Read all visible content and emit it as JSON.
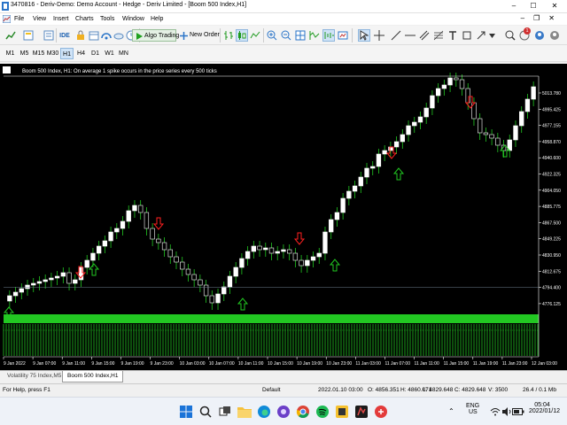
{
  "window": {
    "title": "3470816 - Deriv-Demo: Demo Account - Hedge - Deriv Limited - [Boom 500 Index,H1]",
    "controls": [
      "–",
      "☐",
      "✕"
    ]
  },
  "menu": {
    "items": [
      "File",
      "View",
      "Insert",
      "Charts",
      "Tools",
      "Window",
      "Help"
    ],
    "right_controls": [
      "–",
      "❐",
      "✕"
    ]
  },
  "toolbar": {
    "ide_label": "IDE",
    "algo_trading_label": "Algo Trading",
    "new_order_label": "New Order",
    "notification_count": "1"
  },
  "timeframes": {
    "items": [
      "M1",
      "M5",
      "M15",
      "M30",
      "H1",
      "H4",
      "D1",
      "W1",
      "MN"
    ],
    "active": "H1"
  },
  "chart": {
    "header_text": "Boom 500 Index, H1:  On average 1 spike occurs in the price series every 500 ticks",
    "price_labels": [
      "5013.780",
      "4995.425",
      "4977.155",
      "4958.870",
      "4940.600",
      "4922.325",
      "4904.050",
      "4885.775",
      "4867.500",
      "4849.225",
      "4830.950",
      "4812.675",
      "4794.400",
      "4776.125"
    ],
    "current_price_label": "4794.400",
    "time_labels": [
      "9 Jan 2022",
      "9 Jan 07:00",
      "9 Jan 11:00",
      "9 Jan 15:00",
      "9 Jan 19:00",
      "9 Jan 23:00",
      "10 Jan 03:00",
      "10 Jan 07:00",
      "10 Jan 11:00",
      "10 Jan 15:00",
      "10 Jan 19:00",
      "10 Jan 23:00",
      "11 Jan 03:00",
      "11 Jan 07:00",
      "11 Jan 11:00",
      "11 Jan 15:00",
      "11 Jan 19:00",
      "11 Jan 23:00",
      "12 Jan 03:00"
    ],
    "colors": {
      "background": "#000000",
      "bull_candle": "#ffffff",
      "bear_candle": "#ffffff",
      "wick": "#22c822",
      "up_arrow": "#22c822",
      "down_arrow": "#ff2020",
      "histogram": "#22c822"
    }
  },
  "chart_tabs": {
    "items": [
      "Volatility 75 Index,M5",
      "Boom 500 Index,H1"
    ],
    "active_index": 1
  },
  "status": {
    "help": "For Help, press F1",
    "profile": "Default",
    "datetime": "2022.01.10 03:00",
    "open": "O: 4856.351",
    "high": "H: 4860.071",
    "low": "L: 4829.648",
    "close": "C: 4829.648",
    "volume": "V: 3500",
    "traffic": "26.4 / 0.1 Mb"
  },
  "taskbar": {
    "apps": [
      "windows-start",
      "search",
      "task-view",
      "file-explorer",
      "edge",
      "app-purple",
      "chrome",
      "spotify",
      "app-yellow",
      "metatrader",
      "app-red"
    ],
    "tray": {
      "lang_top": "ENG",
      "lang_bottom": "US",
      "time": "05:04",
      "date": "2022/01/12"
    }
  }
}
